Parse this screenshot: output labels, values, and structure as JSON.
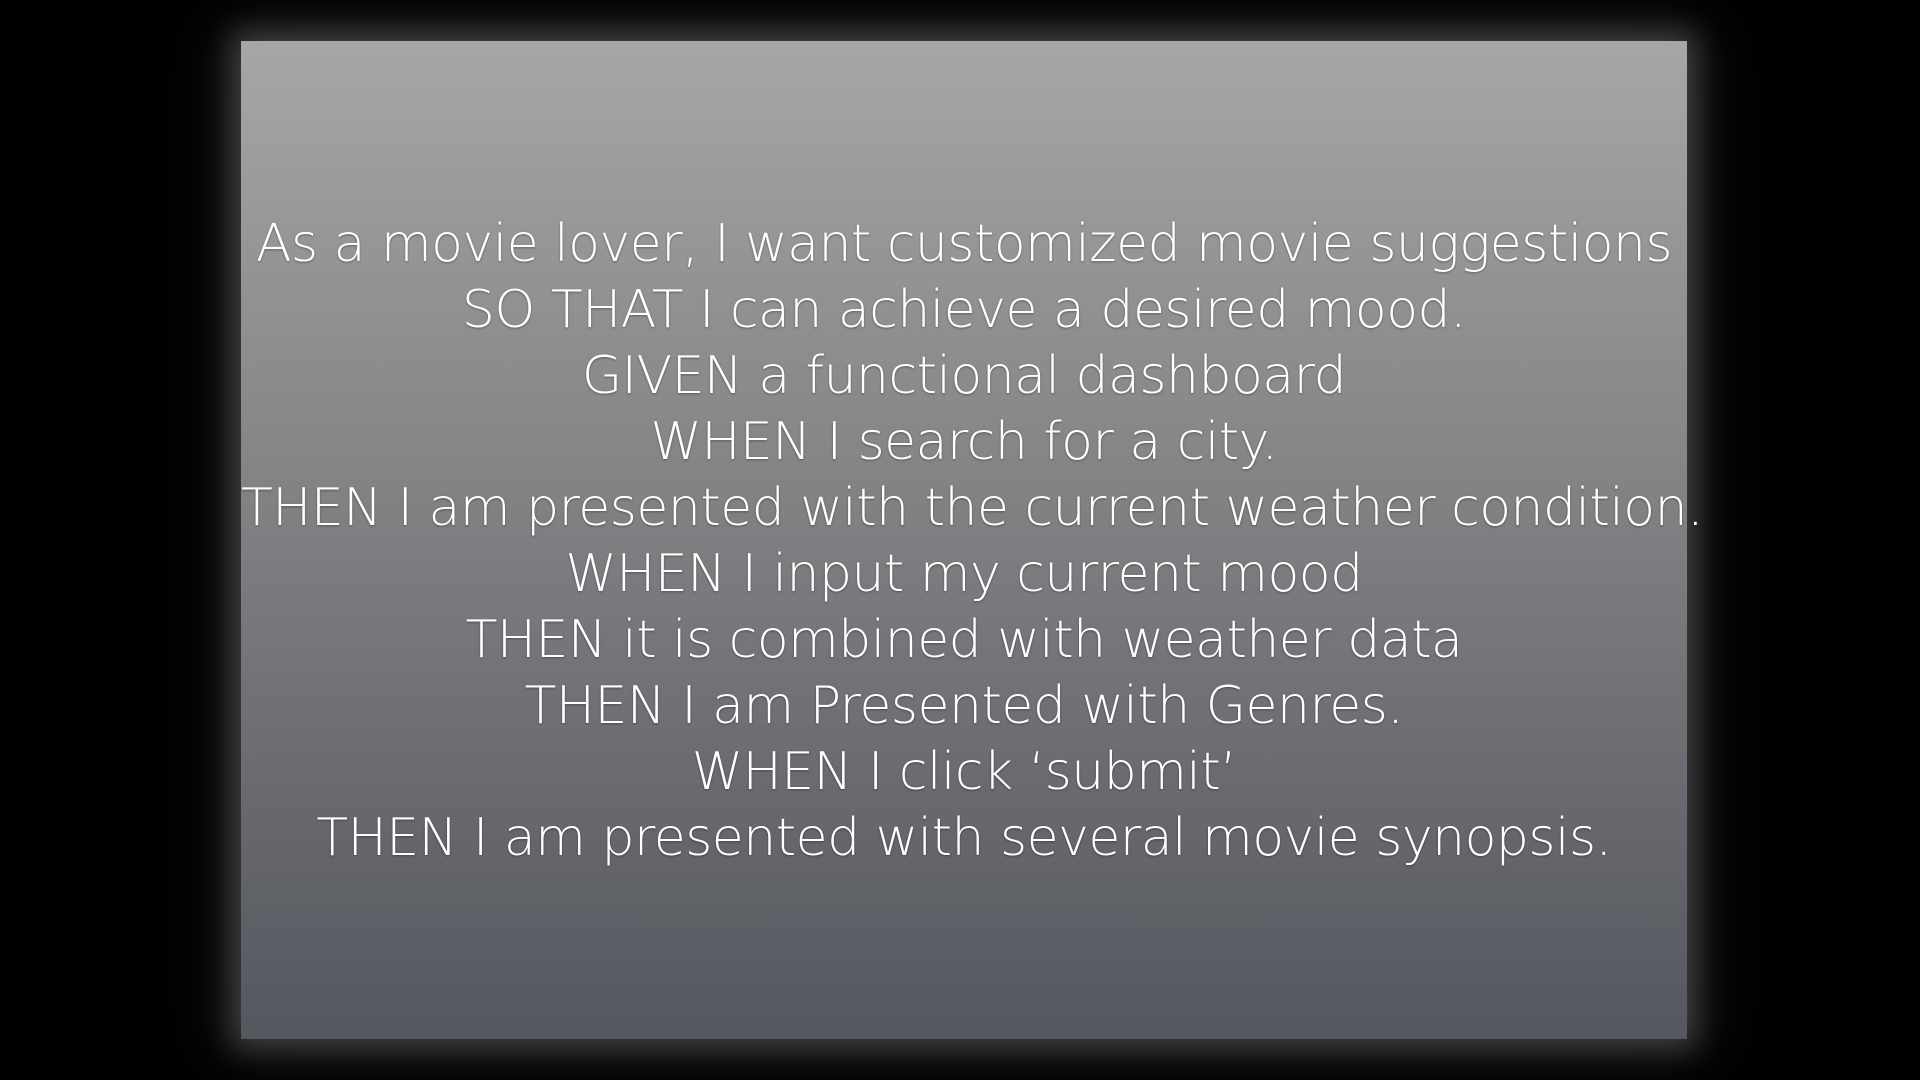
{
  "slide": {
    "lines": [
      "As a movie lover, I want customized movie suggestions",
      "SO THAT I can achieve a desired mood.",
      "GIVEN a functional dashboard",
      "WHEN I search for a city.",
      "THEN I am presented with the current weather condition.",
      "WHEN I input my current mood",
      "THEN it is combined with weather data",
      "THEN I am Presented with Genres.",
      "WHEN I click ‘submit’",
      "THEN I am presented with several movie synopsis."
    ]
  }
}
